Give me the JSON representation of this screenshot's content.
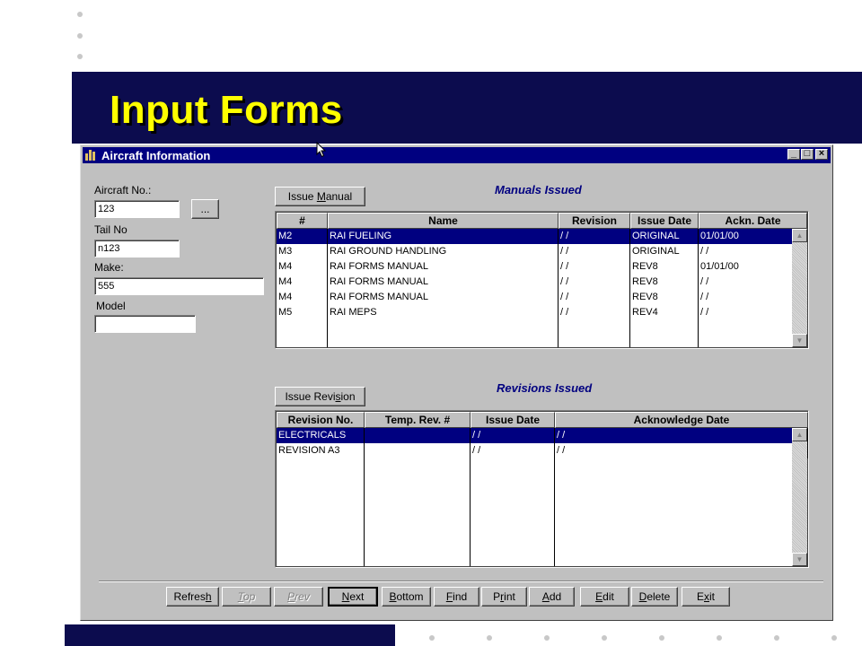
{
  "slide": {
    "title": "Input Forms"
  },
  "window": {
    "title": "Aircraft Information",
    "controls": {
      "minimize": "_",
      "maximize": "□",
      "close": "×"
    }
  },
  "form": {
    "aircraft_no": {
      "label": "Aircraft No.:",
      "value": "123",
      "lookup_label": "..."
    },
    "tail_no": {
      "label": "Tail No",
      "value": "n123"
    },
    "make": {
      "label": "Make:",
      "value": "555"
    },
    "model": {
      "label": "Model",
      "value": ""
    }
  },
  "manuals": {
    "button_label": "Issue Manual",
    "title": "Manuals Issued",
    "columns": [
      "#",
      "Name",
      "Revision",
      "Issue Date",
      "Ackn. Date"
    ],
    "rows": [
      [
        "M2",
        "RAI FUELING",
        " / /",
        "ORIGINAL",
        "01/01/00"
      ],
      [
        "M3",
        "RAI GROUND HANDLING",
        " / /",
        "ORIGINAL",
        " / /"
      ],
      [
        "M4",
        "RAI FORMS  MANUAL",
        " / /",
        "REV8",
        "01/01/00"
      ],
      [
        "M4",
        "RAI FORMS  MANUAL",
        " / /",
        "REV8",
        " / /"
      ],
      [
        "M4",
        "RAI FORMS  MANUAL",
        " / /",
        "REV8",
        " / /"
      ],
      [
        "M5",
        "RAI MEPS",
        " / /",
        "REV4",
        " / /"
      ]
    ],
    "selected_row": 0
  },
  "revisions": {
    "button_label": "Issue Revision",
    "title": "Revisions Issued",
    "columns": [
      "Revision No.",
      "Temp. Rev. #",
      "Issue Date",
      "Acknowledge Date"
    ],
    "rows": [
      [
        "ELECTRICALS",
        "",
        " / /",
        " / /"
      ],
      [
        "REVISION A3",
        "",
        " / /",
        " / /"
      ]
    ],
    "selected_row": 0
  },
  "toolbar": {
    "buttons": [
      {
        "label": "Refresh",
        "state": "enabled"
      },
      {
        "label": "Top",
        "state": "disabled"
      },
      {
        "label": "Prev",
        "state": "disabled"
      },
      {
        "label": "Next",
        "state": "focused"
      },
      {
        "label": "Bottom",
        "state": "enabled"
      },
      {
        "label": "Find",
        "state": "enabled"
      },
      {
        "label": "Print",
        "state": "enabled"
      },
      {
        "label": "Add",
        "state": "enabled"
      },
      {
        "label": "Edit",
        "state": "enabled"
      },
      {
        "label": "Delete",
        "state": "enabled"
      },
      {
        "label": "Exit",
        "state": "enabled"
      }
    ]
  },
  "colors": {
    "banner": "#0c0c4e",
    "title_text": "#ffff00",
    "selection": "#000080",
    "window_face": "#c0c0c0"
  }
}
